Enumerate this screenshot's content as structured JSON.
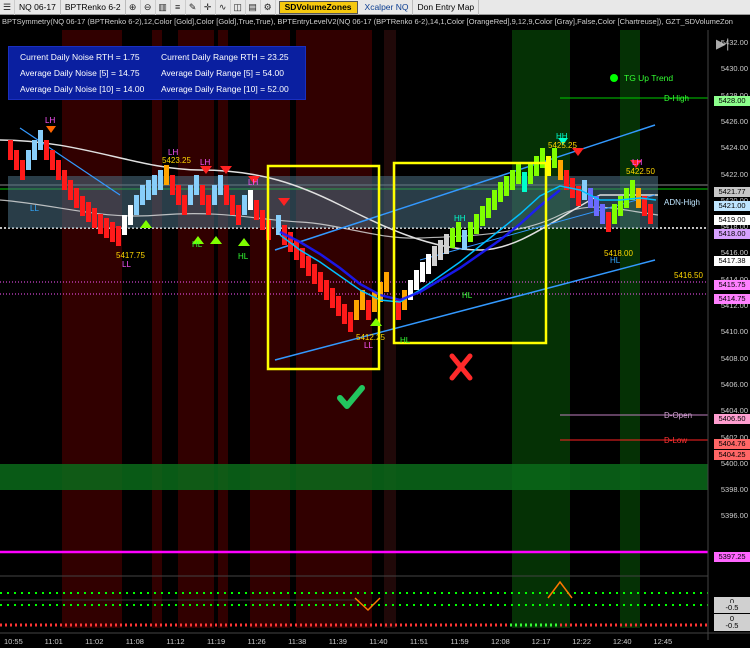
{
  "toolbar": {
    "instrument": "NQ 06-17",
    "bar_type": "BPTRenko 6-2",
    "accent_tab": "SDVolumeZones",
    "xcalper": "Xcalper NQ",
    "entry_map": "Don Entry Map"
  },
  "indicator_line": "BPTSymmetry(NQ 06-17 (BPTRenko 6-2),12,Color [Gold],Color [Gold],True,True), BPTEntryLevelV2(NQ 06-17 (BPTRenko 6-2),14,1,Color [OrangeRed],9,12,9,Color [Gray],False,Color [Chartreuse]), GZT_SDVolumeZon",
  "stats": {
    "noise_rth": "Current Daily Noise RTH = 1.75",
    "noise_5": "Average Daily Noise [5] = 14.75",
    "noise_10": "Average Daily Noise [10] = 14.00",
    "range_rth": "Current Daily Range RTH = 23.25",
    "range_5": "Average Daily Range [5] = 54.00",
    "range_10": "Average Daily Range [10] = 52.00"
  },
  "legend": {
    "trend": "TG Up Trend",
    "color": "#00ff00"
  },
  "levels": {
    "d_high": "D-High",
    "adn_high": "ADN-High",
    "d_open": "D-Open",
    "d_low": "D-Low",
    "lvl_5416": "5416.50"
  },
  "swing_labels": {
    "lh1": "LH",
    "lh2": "LH",
    "lh3": "LH",
    "lh4": "LH",
    "lh5": "LH",
    "hh1": "HH",
    "hh2": "HH",
    "ll1": "LL",
    "ll2": "LL",
    "ll3": "LL",
    "hl1": "HL",
    "hl2": "HL",
    "hl3": "HL",
    "hl4": "HL",
    "hl5": "HL",
    "p5423": "5423.25",
    "p5417": "5417.75",
    "p5412": "5412.25",
    "p5425": "5425.25",
    "p5422": "5422.50",
    "p5418": "5418.00"
  },
  "price_axis": [
    "5432.00",
    "5430.00",
    "5428.00",
    "5426.00",
    "5424.00",
    "5422.00",
    "5420.00",
    "5418.00",
    "5416.00",
    "5414.00",
    "5412.00",
    "5410.00",
    "5408.00",
    "5406.00",
    "5404.00",
    "5402.00",
    "5400.00",
    "5398.00",
    "5396.00"
  ],
  "price_tags": [
    {
      "label": "5428.00",
      "color": "#8cff8c"
    },
    {
      "label": "5421.77",
      "color": "#c8c8c8"
    },
    {
      "label": "5421.00",
      "color": "#bfe6ff"
    },
    {
      "label": "5419.00",
      "color": "#ffffff"
    },
    {
      "label": "5418.00",
      "color": "#d7a0ff"
    },
    {
      "label": "5417.38",
      "color": "#ffffff"
    },
    {
      "label": "5415.75",
      "color": "#ff80ff"
    },
    {
      "label": "5414.75",
      "color": "#ff80ff"
    },
    {
      "label": "5406.50",
      "color": "#ff9ed0"
    },
    {
      "label": "5404.76",
      "color": "#ff6666"
    },
    {
      "label": "5404.25",
      "color": "#ff6666"
    },
    {
      "label": "5397.25",
      "color": "#ff66ff"
    },
    {
      "label": "0",
      "color": "#d0d0d0"
    },
    {
      "label": "-0.5",
      "color": "#d0d0d0"
    },
    {
      "label": "0",
      "color": "#d0d0d0"
    },
    {
      "label": "-0.5",
      "color": "#d0d0d0"
    }
  ],
  "time_axis": [
    "10:55",
    "11:01",
    "11:02",
    "11:08",
    "11:12",
    "11:19",
    "11:26",
    "11:38",
    "11:39",
    "11:40",
    "11:51",
    "11:59",
    "12:08",
    "12:17",
    "12:22",
    "12:40",
    "12:45"
  ],
  "annotations": {
    "good_trade": "check",
    "bad_trade": "cross"
  },
  "colors": {
    "up_bar": "#7fff00",
    "down_bar": "#ff1a1a",
    "box": "#ffff00",
    "stats_bg": "#0a1fa0"
  }
}
